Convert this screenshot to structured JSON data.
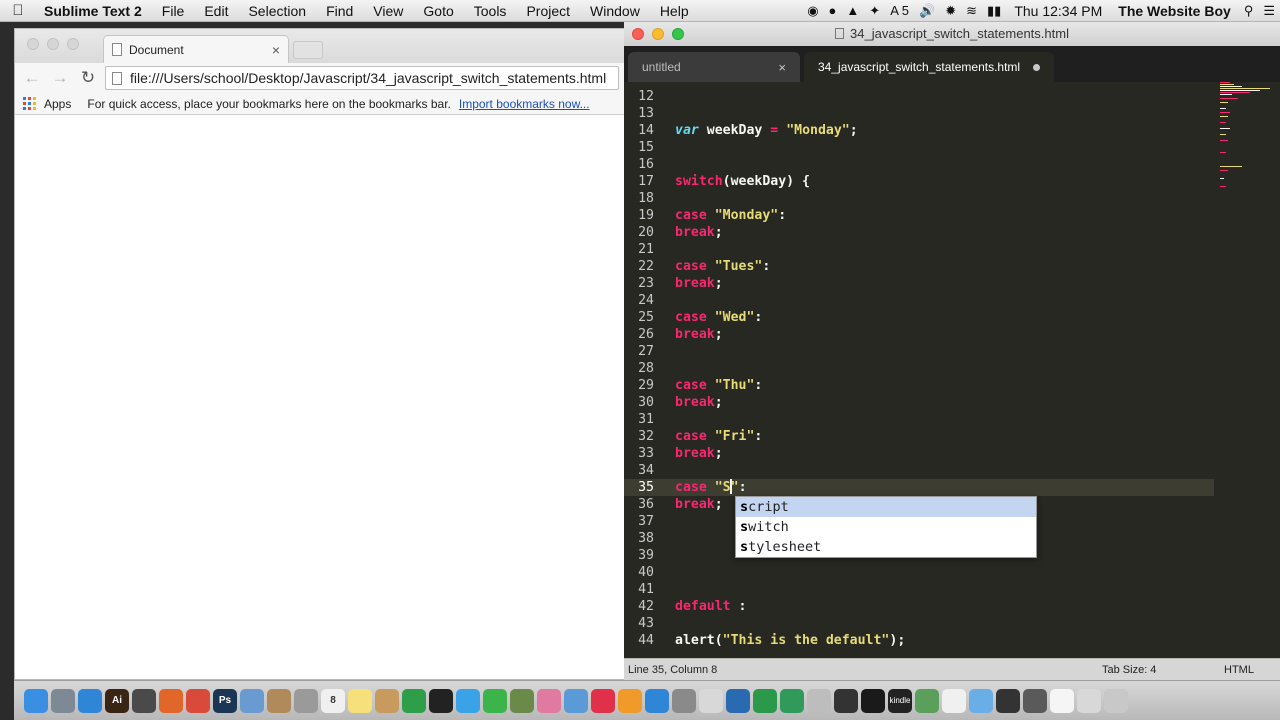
{
  "menubar": {
    "app_name": "Sublime Text 2",
    "menus": [
      "File",
      "Edit",
      "Selection",
      "Find",
      "View",
      "Goto",
      "Tools",
      "Project",
      "Window",
      "Help"
    ],
    "status_5": "5",
    "clock": "Thu 12:34 PM",
    "user": "The Website Boy"
  },
  "chrome": {
    "tab_title": "Document",
    "tab_close": "×",
    "url": "file:///Users/school/Desktop/Javascript/34_javascript_switch_statements.html",
    "apps_label": "Apps",
    "bookmarks_hint": "For quick access, place your bookmarks here on the bookmarks bar.",
    "import_link": "Import bookmarks now..."
  },
  "sublime": {
    "window_title": "34_javascript_switch_statements.html",
    "tabs": [
      {
        "label": "untitled",
        "close": "×"
      },
      {
        "label": "34_javascript_switch_statements.html"
      }
    ],
    "code_lines": [
      {
        "n": "12",
        "code": []
      },
      {
        "n": "13",
        "code": []
      },
      {
        "n": "14",
        "code": [
          {
            "t": "var",
            "c": "vr"
          },
          {
            "t": " weekDay ",
            "c": "plain"
          },
          {
            "t": "=",
            "c": "kw"
          },
          {
            "t": " ",
            "c": "plain"
          },
          {
            "t": "\"Monday\"",
            "c": "str"
          },
          {
            "t": ";",
            "c": "plain"
          }
        ]
      },
      {
        "n": "15",
        "code": []
      },
      {
        "n": "16",
        "code": []
      },
      {
        "n": "17",
        "code": [
          {
            "t": "switch",
            "c": "kw"
          },
          {
            "t": "(weekDay) {",
            "c": "plain"
          }
        ]
      },
      {
        "n": "18",
        "code": []
      },
      {
        "n": "19",
        "code": [
          {
            "t": "case",
            "c": "kw"
          },
          {
            "t": " ",
            "c": "plain"
          },
          {
            "t": "\"Monday\"",
            "c": "str"
          },
          {
            "t": ":",
            "c": "plain"
          }
        ]
      },
      {
        "n": "20",
        "code": [
          {
            "t": "break",
            "c": "kw"
          },
          {
            "t": ";",
            "c": "plain"
          }
        ]
      },
      {
        "n": "21",
        "code": []
      },
      {
        "n": "22",
        "code": [
          {
            "t": "case",
            "c": "kw"
          },
          {
            "t": " ",
            "c": "plain"
          },
          {
            "t": "\"Tues\"",
            "c": "str"
          },
          {
            "t": ":",
            "c": "plain"
          }
        ]
      },
      {
        "n": "23",
        "code": [
          {
            "t": "break",
            "c": "kw"
          },
          {
            "t": ";",
            "c": "plain"
          }
        ]
      },
      {
        "n": "24",
        "code": []
      },
      {
        "n": "25",
        "code": [
          {
            "t": "case",
            "c": "kw"
          },
          {
            "t": " ",
            "c": "plain"
          },
          {
            "t": "\"Wed\"",
            "c": "str"
          },
          {
            "t": ":",
            "c": "plain"
          }
        ]
      },
      {
        "n": "26",
        "code": [
          {
            "t": "break",
            "c": "kw"
          },
          {
            "t": ";",
            "c": "plain"
          }
        ]
      },
      {
        "n": "27",
        "code": []
      },
      {
        "n": "28",
        "code": []
      },
      {
        "n": "29",
        "code": [
          {
            "t": "case",
            "c": "kw"
          },
          {
            "t": " ",
            "c": "plain"
          },
          {
            "t": "\"Thu\"",
            "c": "str"
          },
          {
            "t": ":",
            "c": "plain"
          }
        ]
      },
      {
        "n": "30",
        "code": [
          {
            "t": "break",
            "c": "kw"
          },
          {
            "t": ";",
            "c": "plain"
          }
        ]
      },
      {
        "n": "31",
        "code": []
      },
      {
        "n": "32",
        "code": [
          {
            "t": "case",
            "c": "kw"
          },
          {
            "t": " ",
            "c": "plain"
          },
          {
            "t": "\"Fri\"",
            "c": "str"
          },
          {
            "t": ":",
            "c": "plain"
          }
        ]
      },
      {
        "n": "33",
        "code": [
          {
            "t": "break",
            "c": "kw"
          },
          {
            "t": ";",
            "c": "plain"
          }
        ]
      },
      {
        "n": "34",
        "code": []
      },
      {
        "n": "35",
        "code": [
          {
            "t": "case",
            "c": "kw"
          },
          {
            "t": " ",
            "c": "plain"
          },
          {
            "t": "\"S",
            "c": "str"
          },
          {
            "t": "|",
            "c": "cursor"
          },
          {
            "t": "\"",
            "c": "str"
          },
          {
            "t": ":",
            "c": "plain"
          }
        ],
        "current": true
      },
      {
        "n": "36",
        "code": [
          {
            "t": "break",
            "c": "kw"
          },
          {
            "t": ";",
            "c": "plain"
          }
        ]
      },
      {
        "n": "37",
        "code": []
      },
      {
        "n": "38",
        "code": []
      },
      {
        "n": "39",
        "code": []
      },
      {
        "n": "40",
        "code": []
      },
      {
        "n": "41",
        "code": []
      },
      {
        "n": "42",
        "code": [
          {
            "t": "default",
            "c": "kw"
          },
          {
            "t": " :",
            "c": "plain"
          }
        ]
      },
      {
        "n": "43",
        "code": []
      },
      {
        "n": "44",
        "code": [
          {
            "t": "alert(",
            "c": "plain"
          },
          {
            "t": "\"This is the default\"",
            "c": "str"
          },
          {
            "t": ");",
            "c": "plain"
          }
        ]
      }
    ],
    "autocomplete": [
      {
        "prefix": "s",
        "rest": "cript",
        "selected": true
      },
      {
        "prefix": "s",
        "rest": "witch"
      },
      {
        "prefix": "s",
        "rest": "tylesheet"
      }
    ],
    "status": {
      "position": "Line 35, Column 8",
      "tab_size": "Tab Size: 4",
      "syntax": "HTML"
    }
  },
  "dock": {
    "items": [
      {
        "icon": "finder-icon",
        "color": "#3b8fe3"
      },
      {
        "icon": "launchpad-icon",
        "color": "#7d8a96"
      },
      {
        "icon": "safari-icon",
        "color": "#2f86d6"
      },
      {
        "icon": "illustrator-icon",
        "color": "#3a2414"
      },
      {
        "icon": "sublime-icon",
        "color": "#4a4a4a"
      },
      {
        "icon": "firefox-icon",
        "color": "#e0662a"
      },
      {
        "icon": "chrome-icon",
        "color": "#d94a3a"
      },
      {
        "icon": "photoshop-icon",
        "color": "#1a3654"
      },
      {
        "icon": "preview-icon",
        "color": "#6a9bd0"
      },
      {
        "icon": "archive-icon",
        "color": "#b08a5a"
      },
      {
        "icon": "help-icon",
        "color": "#9a9a9a"
      },
      {
        "icon": "calendar-icon",
        "color": "#f0f0f0"
      },
      {
        "icon": "notes-icon",
        "color": "#f5e07a"
      },
      {
        "icon": "contacts-icon",
        "color": "#c89a5e"
      },
      {
        "icon": "tripadvisor-icon",
        "color": "#2e9e4a"
      },
      {
        "icon": "terminal-icon",
        "color": "#222222"
      },
      {
        "icon": "messages-icon",
        "color": "#3aa3e8"
      },
      {
        "icon": "facetime-icon",
        "color": "#3bb54a"
      },
      {
        "icon": "photo-icon",
        "color": "#6a8a4a"
      },
      {
        "icon": "photos-icon",
        "color": "#e07aa0"
      },
      {
        "icon": "maps-icon",
        "color": "#5a9ad6"
      },
      {
        "icon": "itunes-icon",
        "color": "#e0304a"
      },
      {
        "icon": "ibooks-icon",
        "color": "#f09a2a"
      },
      {
        "icon": "appstore-icon",
        "color": "#2f86d6"
      },
      {
        "icon": "preferences-icon",
        "color": "#8a8a8a"
      },
      {
        "icon": "script-icon",
        "color": "#d8d8d8"
      },
      {
        "icon": "video-icon",
        "color": "#2a6ab0"
      },
      {
        "icon": "color-icon",
        "color": "#2a9a4a"
      },
      {
        "icon": "vine-icon",
        "color": "#2f9a5a"
      },
      {
        "icon": "utility-icon",
        "color": "#bdbdbd"
      },
      {
        "icon": "github-icon",
        "color": "#333333"
      },
      {
        "icon": "terminal2-icon",
        "color": "#1a1a1a"
      },
      {
        "icon": "kindle-icon",
        "color": "#222222"
      },
      {
        "icon": "bird-icon",
        "color": "#5aa05a"
      },
      {
        "icon": "document-icon",
        "color": "#f0f0f0"
      },
      {
        "icon": "folder-icon",
        "color": "#6aaee8"
      },
      {
        "icon": "monitor-icon",
        "color": "#333333"
      },
      {
        "icon": "screen-icon",
        "color": "#5a5a5a"
      },
      {
        "icon": "paper-icon",
        "color": "#f5f5f5"
      },
      {
        "icon": "downloads-icon",
        "color": "#d8d8d8"
      },
      {
        "icon": "trash-icon",
        "color": "#c8c8c8"
      }
    ],
    "illustrator_label": "Ai",
    "photoshop_label": "Ps",
    "calendar_label": "8",
    "kindle_label": "kindle"
  }
}
